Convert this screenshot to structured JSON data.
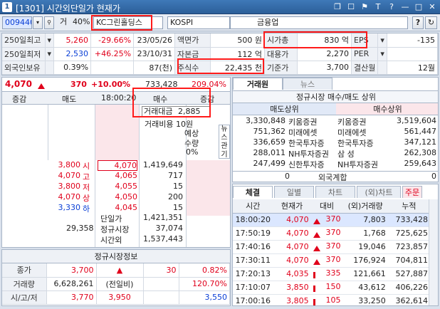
{
  "window": {
    "title": "[1301] 시간외단일가 현재가",
    "app_icon": "1"
  },
  "titlebar_buttons": [
    "❐",
    "☐",
    "⚑",
    "T",
    "?",
    "—",
    "□",
    "✕"
  ],
  "toolbar": {
    "code": "009440",
    "market_prefix": "거",
    "margin": "40%",
    "stock_name": "KC그린홀딩스",
    "market": "KOSPI",
    "sector": "금융업",
    "help": "?",
    "refresh": "↻",
    "settings": "⚙"
  },
  "info_rows": [
    {
      "label1": "250일최고",
      "drop": "▾",
      "v1": "5,260",
      "v1c": "red",
      "pct": "-29.66%",
      "pctc": "red",
      "date": "23/05/26",
      "label2": "액면가",
      "v2": "500 원",
      "label3": "시가총",
      "v3": "830 억",
      "label4": "EPS",
      "drop4": "▾",
      "v4": "-135"
    },
    {
      "label1": "250일최저",
      "drop": "▾",
      "v1": "2,530",
      "v1c": "blue",
      "pct": "+46.25%",
      "pctc": "red",
      "date": "23/10/31",
      "label2": "자본금",
      "v2": "112 억",
      "label3": "대용가",
      "v3": "2,270",
      "label4": "PER",
      "drop4": "▾",
      "v4": ""
    },
    {
      "label1": "외국인보유",
      "drop": "",
      "v1": "0.39%",
      "v1c": "",
      "pct": "",
      "pctc": "",
      "date": "87(천)",
      "label2": "주식수",
      "v2": "22,435 천",
      "label3": "기준가",
      "v3": "3,700",
      "label4": "결산월",
      "drop4": "",
      "v4": "12월"
    }
  ],
  "pricebar": {
    "price": "4,070",
    "change": "370",
    "pct": "+10.00%",
    "volume": "733,428",
    "vol_pct": "209.04%"
  },
  "orderbook": {
    "headers": [
      "증감",
      "매도",
      "18:00:20",
      "매수",
      "증감"
    ],
    "trade_amount_label": "거래대금",
    "trade_amount": "2,885",
    "trade_cost_label": "거래비용 10원",
    "expected_label": "예상",
    "qty_label": "수량",
    "qty_pct": "0%",
    "side_labels": [
      "뉴",
      "스",
      "관",
      "기"
    ],
    "levels": [
      {
        "ref": "3,800",
        "tag": "시",
        "price": "4,070",
        "vol": "1,419,649",
        "refc": "red"
      },
      {
        "ref": "4,070",
        "tag": "고",
        "price": "4,065",
        "vol": "717",
        "refc": "red"
      },
      {
        "ref": "3,800",
        "tag": "저",
        "price": "4,055",
        "vol": "15",
        "refc": "red"
      },
      {
        "ref": "4,070",
        "tag": "상",
        "price": "4,050",
        "vol": "200",
        "refc": "red"
      },
      {
        "ref": "3,330",
        "tag": "하",
        "price": "4,045",
        "vol": "15",
        "refc": "blue"
      }
    ],
    "summary": [
      {
        "label": "단일가",
        "val": "1,421,351"
      },
      {
        "left": "29,358",
        "label": "정규시장",
        "val": "37,074"
      },
      {
        "label": "시간외",
        "val": "1,537,443"
      }
    ]
  },
  "closing": {
    "title": "정규시장정보",
    "rows": [
      {
        "label": "종가",
        "a": "3,700",
        "ac": "red",
        "b": "▲",
        "bc": "red",
        "c": "30",
        "cc": "red",
        "d": "0.82%",
        "dc": "red"
      },
      {
        "label": "거래량",
        "a": "6,628,261",
        "ac": "",
        "b": "(전일비)",
        "bc": "",
        "c": "",
        "cc": "",
        "d": "120.70%",
        "dc": "red"
      },
      {
        "label": "시/고/저",
        "a": "3,770",
        "ac": "red",
        "b": "3,950",
        "bc": "red",
        "c": "",
        "cc": "",
        "d": "3,550",
        "dc": "blue"
      }
    ]
  },
  "broker": {
    "tabs": [
      "거래원",
      "뉴스"
    ],
    "title": "정규시장 매수/매도 상위",
    "sell_header": "매도상위",
    "buy_header": "매수상위",
    "rows": [
      {
        "sv": "3,330,848",
        "sn": "키움증권",
        "bn": "키움증권",
        "bv": "3,519,604"
      },
      {
        "sv": "751,362",
        "sn": "미래에셋",
        "bn": "미래에셋",
        "bv": "561,447"
      },
      {
        "sv": "336,659",
        "sn": "한국투자증",
        "bn": "한국투자증",
        "bv": "347,121"
      },
      {
        "sv": "288,011",
        "sn": "NH투자증권",
        "bn": "삼 성",
        "bv": "262,308"
      },
      {
        "sv": "247,499",
        "sn": "신한투자증",
        "bn": "NH투자증권",
        "bv": "259,643"
      }
    ],
    "foreign": {
      "left": "0",
      "label": "외국계합",
      "right": "0"
    }
  },
  "trades": {
    "tabs": [
      "체결",
      "일별",
      "차트",
      "(외)차트",
      "주문"
    ],
    "headers": [
      "시간",
      "현재가",
      "대비",
      "(외)거래량",
      "누적"
    ],
    "rows": [
      {
        "t": "18:00:20",
        "p": "4,070",
        "d": "370",
        "v": "7,803",
        "cum": "733,428",
        "arrow": "up"
      },
      {
        "t": "17:50:19",
        "p": "4,070",
        "d": "370",
        "v": "1,768",
        "cum": "725,625",
        "arrow": "up"
      },
      {
        "t": "17:40:16",
        "p": "4,070",
        "d": "370",
        "v": "19,046",
        "cum": "723,857",
        "arrow": "up"
      },
      {
        "t": "17:30:11",
        "p": "4,070",
        "d": "370",
        "v": "176,924",
        "cum": "704,811",
        "arrow": "up"
      },
      {
        "t": "17:20:13",
        "p": "4,035",
        "d": "335",
        "v": "121,661",
        "cum": "527,887",
        "arrow": "bar"
      },
      {
        "t": "17:10:07",
        "p": "3,850",
        "d": "150",
        "v": "43,612",
        "cum": "406,226",
        "arrow": "bar"
      },
      {
        "t": "17:00:16",
        "p": "3,805",
        "d": "105",
        "v": "33,250",
        "cum": "362,614",
        "arrow": "bar"
      }
    ]
  }
}
